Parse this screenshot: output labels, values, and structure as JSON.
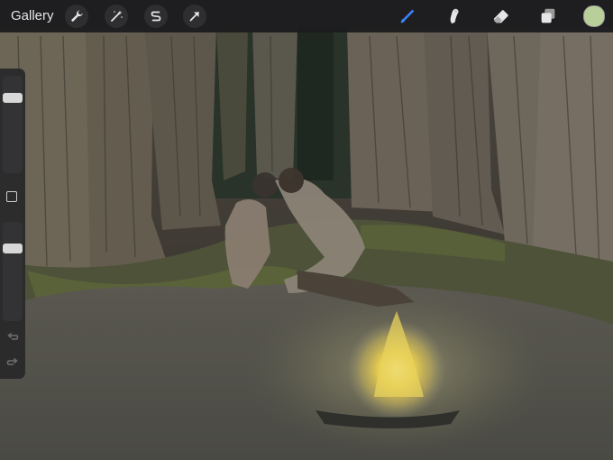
{
  "toolbar": {
    "gallery_label": "Gallery",
    "left_tools": [
      "wrench-icon",
      "magic-wand-icon",
      "selection-s-icon",
      "transform-arrow-icon"
    ],
    "right_tools": [
      "brush-icon",
      "smudge-icon",
      "eraser-icon",
      "layers-icon"
    ],
    "active_tool": "brush",
    "accent_color": "#3b82f6",
    "current_color": "#b9cf9a"
  },
  "sidebar": {
    "brush_size": 0.2,
    "opacity": 0.24
  }
}
